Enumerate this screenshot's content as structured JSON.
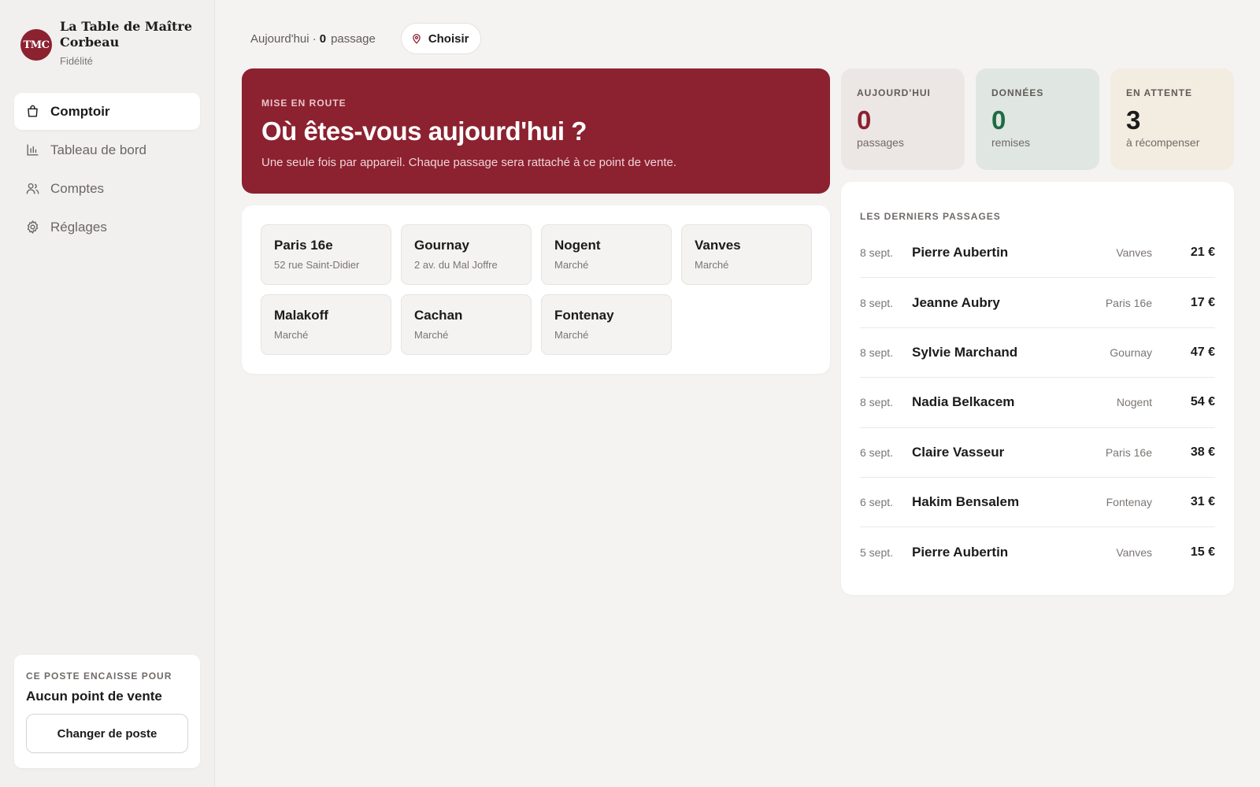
{
  "brand": {
    "logo_text": "TMC",
    "name": "La Table de Maître Corbeau",
    "subtitle": "Fidélité",
    "color": "#8c2130"
  },
  "nav": {
    "items": [
      {
        "label": "Comptoir",
        "icon": "shopping-bag-icon",
        "active": true
      },
      {
        "label": "Tableau de bord",
        "icon": "bar-chart-icon",
        "active": false
      },
      {
        "label": "Comptes",
        "icon": "users-icon",
        "active": false
      },
      {
        "label": "Réglages",
        "icon": "gear-icon",
        "active": false
      }
    ]
  },
  "poste": {
    "label": "CE POSTE ENCAISSE POUR",
    "value": "Aucun point de vente",
    "button": "Changer de poste"
  },
  "topbar": {
    "today_prefix": "Aujourd'hui ·",
    "today_count": "0",
    "today_suffix": "passage",
    "choose_label": "Choisir"
  },
  "hero": {
    "kicker": "MISE EN ROUTE",
    "title": "Où êtes-vous aujourd'hui ?",
    "text": "Une seule fois par appareil. Chaque passage sera rattaché à ce point de vente."
  },
  "locations": [
    {
      "name": "Paris 16e",
      "address": "52 rue Saint-Didier"
    },
    {
      "name": "Gournay",
      "address": "2 av. du Mal Joffre"
    },
    {
      "name": "Nogent",
      "address": "Marché"
    },
    {
      "name": "Vanves",
      "address": "Marché"
    },
    {
      "name": "Malakoff",
      "address": "Marché"
    },
    {
      "name": "Cachan",
      "address": "Marché"
    },
    {
      "name": "Fontenay",
      "address": "Marché"
    }
  ],
  "stats": [
    {
      "label": "AUJOURD'HUI",
      "value": "0",
      "sub": "passages"
    },
    {
      "label": "DONNÉES",
      "value": "0",
      "sub": "remises"
    },
    {
      "label": "EN ATTENTE",
      "value": "3",
      "sub": "à récompenser"
    }
  ],
  "recent": {
    "title": "LES DERNIERS PASSAGES",
    "rows": [
      {
        "date": "8 sept.",
        "name": "Pierre Aubertin",
        "place": "Vanves",
        "amount": "21 €"
      },
      {
        "date": "8 sept.",
        "name": "Jeanne Aubry",
        "place": "Paris 16e",
        "amount": "17 €"
      },
      {
        "date": "8 sept.",
        "name": "Sylvie Marchand",
        "place": "Gournay",
        "amount": "47 €"
      },
      {
        "date": "8 sept.",
        "name": "Nadia Belkacem",
        "place": "Nogent",
        "amount": "54 €"
      },
      {
        "date": "6 sept.",
        "name": "Claire Vasseur",
        "place": "Paris 16e",
        "amount": "38 €"
      },
      {
        "date": "6 sept.",
        "name": "Hakim Bensalem",
        "place": "Fontenay",
        "amount": "31 €"
      },
      {
        "date": "5 sept.",
        "name": "Pierre Aubertin",
        "place": "Vanves",
        "amount": "15 €"
      }
    ]
  }
}
